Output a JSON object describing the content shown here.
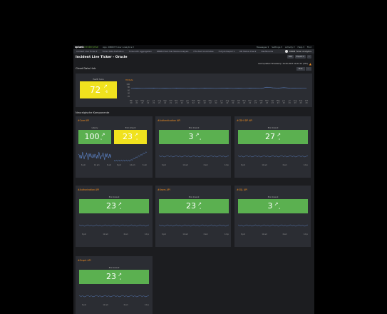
{
  "topbar": {
    "logo_main": "splunk",
    "logo_sub": ">enterprise",
    "tabs": [
      "App: DBRM Ticker Analytics ▾"
    ],
    "right_items": [
      "Messages ▾",
      "Settings ▾",
      "Activity ▾",
      "Help ▾",
      "Find"
    ]
  },
  "nav": {
    "items": [
      "Incident Live Ticker ▾",
      "Ticker Data Definition",
      "Ticker-ATC Aggregation",
      "DBRM Host Hub Status Analysis",
      "ITSI Alert Anomalies",
      "Full Job Report ▾",
      "DB Status Check",
      "Dashboards"
    ],
    "brand": "DBRM Ticker Analytics"
  },
  "page": {
    "title": "Incident Live Ticker - Oracle",
    "actions": [
      "Edit",
      "Export ▾",
      "..."
    ],
    "last_updated": "Last Updated Timestamp: 16-05-2023 14:02:12 (UTC)"
  },
  "hub": {
    "label": "Cloud Data Hub",
    "edit_buttons": [
      "Hide",
      "..."
    ],
    "tile": {
      "label": "Health Score",
      "value": "72",
      "delta": "-6",
      "color": "#f0e21e"
    },
    "chart_title": "Hit Rate",
    "chart_data": {
      "type": "line",
      "ylim": [
        0,
        100
      ],
      "yticks": [
        "100",
        "80",
        "60",
        "40",
        "20"
      ],
      "xticks": [
        "Mar 20",
        "Apr 21",
        "May 21",
        "Jun 21",
        "Jul 21",
        "Aug 21",
        "Sep 21",
        "Oct 21",
        "Nov 21",
        "Dec 21",
        "Jan 22",
        "Feb 22",
        "Mar 22",
        "Apr 22",
        "May 22",
        "Jun 22",
        "Jul 22",
        "Aug 22",
        "Sep 22",
        "Oct 22",
        "Nov 22",
        "Dec 22",
        "Jan 23",
        "Feb 23",
        "Mar 23",
        "Apr 23",
        "May 23",
        "Jun 23",
        "Jul 23",
        "Aug 23",
        "Sep 23",
        "Oct 23"
      ],
      "values": [
        72,
        73,
        72,
        73,
        74,
        72,
        73,
        72,
        74,
        73,
        72,
        73,
        72,
        74,
        73,
        72,
        73,
        74,
        72,
        73,
        72,
        74,
        73,
        72,
        80,
        76,
        74,
        77,
        74,
        73,
        75,
        72
      ],
      "color": "#5a7fc0"
    }
  },
  "components": {
    "label": "Neuralgische Komponente",
    "xticks": [
      "6 pm",
      "12 am",
      "6 am",
      "12 pm"
    ],
    "panels": [
      {
        "title": "#Core API",
        "tiles": [
          {
            "label": "Latency",
            "value": "100",
            "delta": "1",
            "color": "#5bb050"
          },
          {
            "label": "Error Amount",
            "value": "23",
            "delta": "4",
            "color": "#f0e21e"
          }
        ]
      },
      {
        "title": "#Authentication API",
        "tiles": [
          {
            "label": "Error Amount",
            "value": "3",
            "delta": "4",
            "color": "#5bb050"
          }
        ]
      },
      {
        "title": "#CDH IDP API",
        "tiles": [
          {
            "label": "Error Amount",
            "value": "27",
            "delta": "0",
            "color": "#5bb050"
          }
        ]
      },
      {
        "title": "#Authorization API",
        "tiles": [
          {
            "label": "Error Amount",
            "value": "23",
            "delta": "4",
            "color": "#5bb050"
          }
        ]
      },
      {
        "title": "#Users API",
        "tiles": [
          {
            "label": "Error Amount",
            "value": "23",
            "delta": "4",
            "color": "#5bb050"
          }
        ]
      },
      {
        "title": "#SQL API",
        "tiles": [
          {
            "label": "Error Amount",
            "value": "3",
            "delta": "4",
            "color": "#5bb050"
          }
        ]
      },
      {
        "title": "#Graph API",
        "tiles": [
          {
            "label": "Error Amount",
            "value": "23",
            "delta": "4",
            "color": "#5bb050"
          }
        ]
      }
    ]
  }
}
